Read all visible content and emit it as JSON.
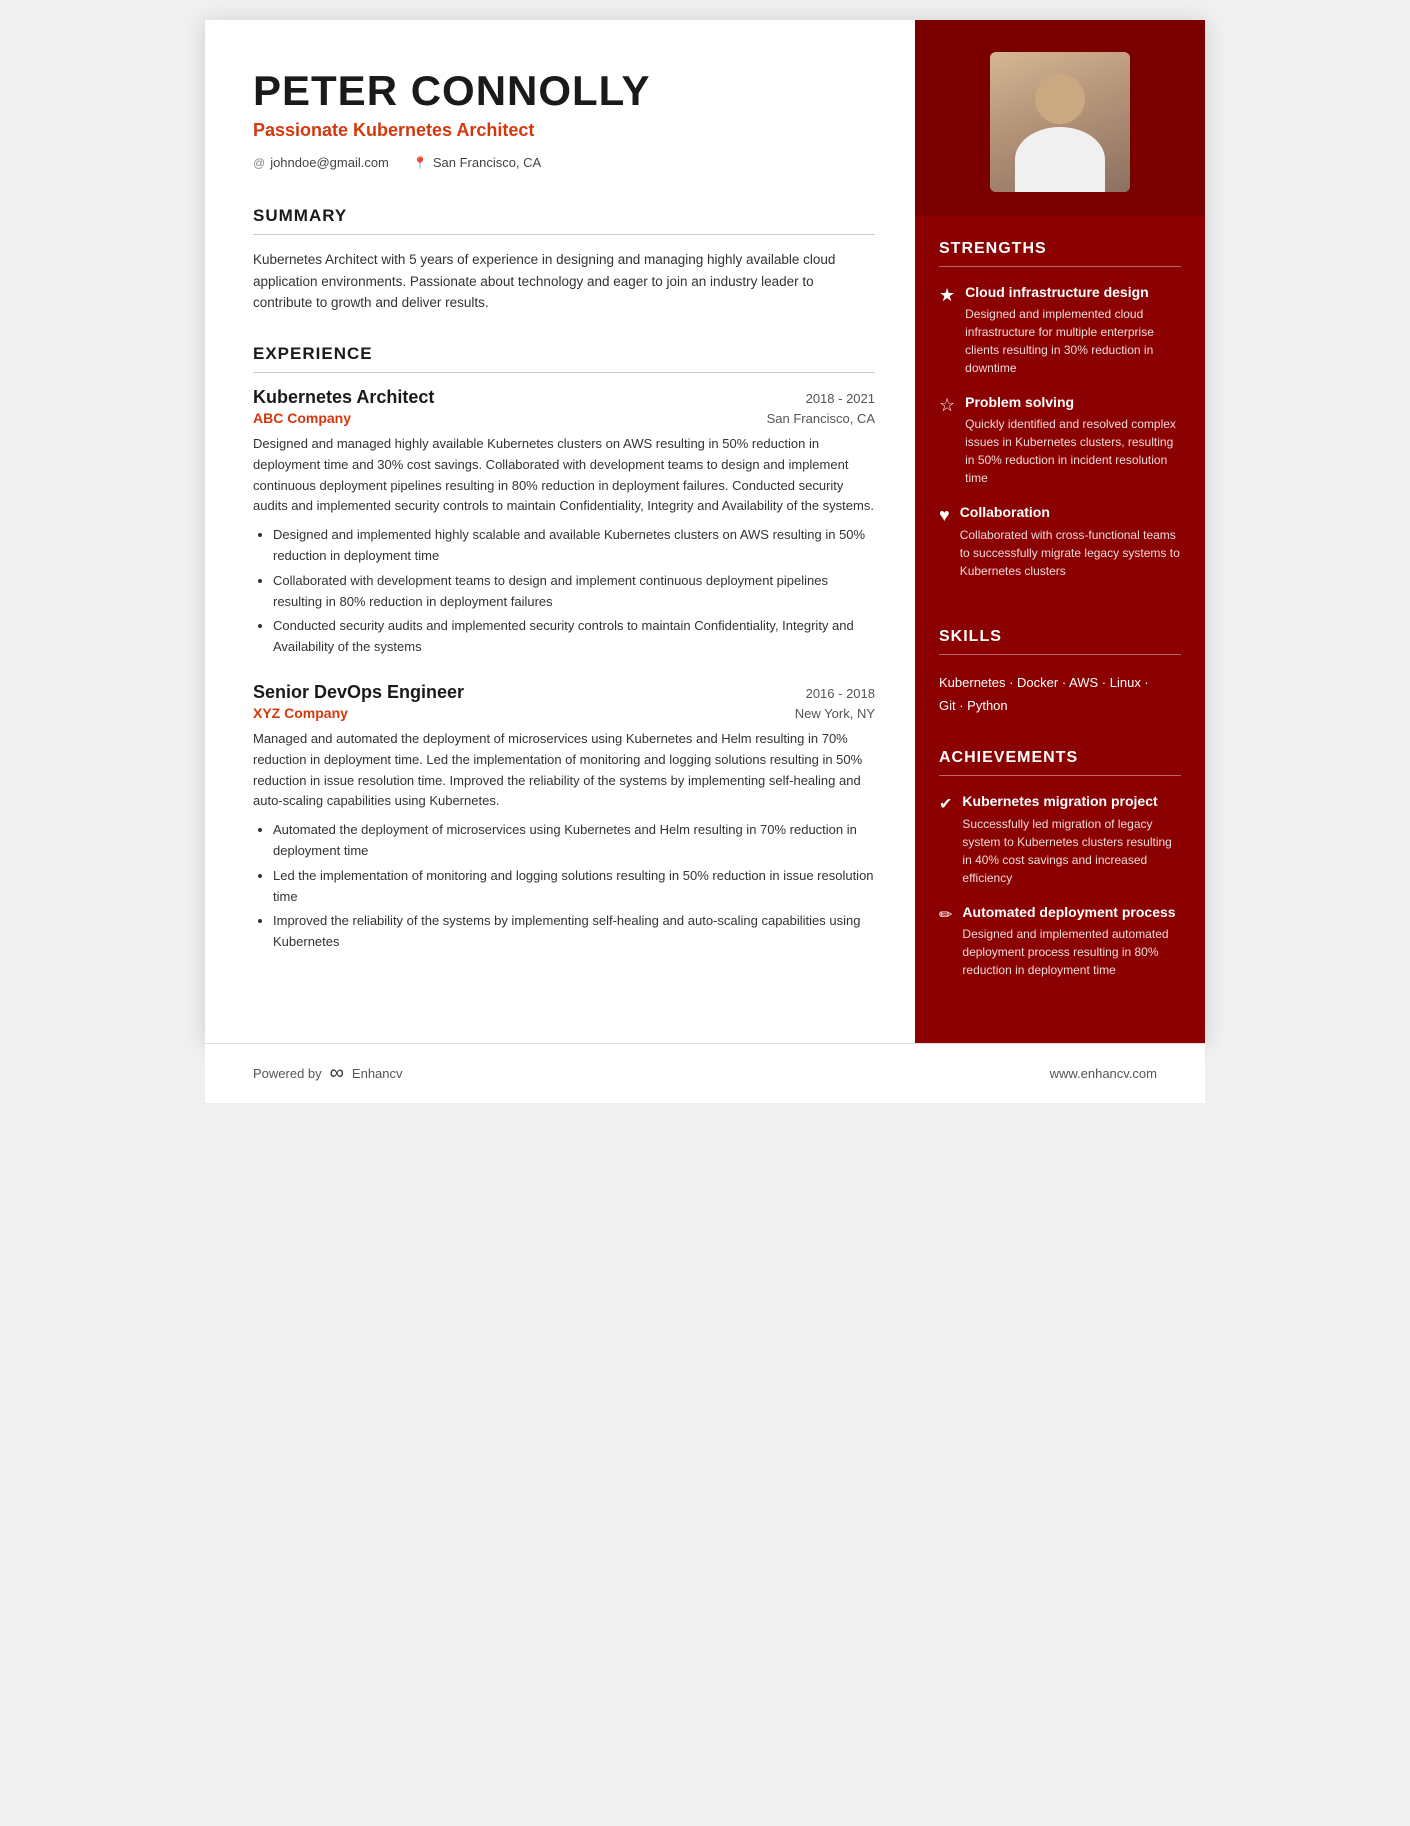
{
  "header": {
    "name": "PETER CONNOLLY",
    "title": "Passionate Kubernetes Architect",
    "email": "johndoe@gmail.com",
    "location": "San Francisco, CA"
  },
  "summary": {
    "section_title": "SUMMARY",
    "text": "Kubernetes Architect with 5 years of experience in designing and managing highly available cloud application environments. Passionate about technology and eager to join an industry leader to contribute to growth and deliver results."
  },
  "experience": {
    "section_title": "EXPERIENCE",
    "jobs": [
      {
        "title": "Kubernetes Architect",
        "company": "ABC Company",
        "dates": "2018 - 2021",
        "location": "San Francisco, CA",
        "description": "Designed and managed highly available Kubernetes clusters on AWS resulting in 50% reduction in deployment time and 30% cost savings. Collaborated with development teams to design and implement continuous deployment pipelines resulting in 80% reduction in deployment failures. Conducted security audits and implemented security controls to maintain Confidentiality, Integrity and Availability of the systems.",
        "bullets": [
          "Designed and implemented highly scalable and available Kubernetes clusters on AWS resulting in 50% reduction in deployment time",
          "Collaborated with development teams to design and implement continuous deployment pipelines resulting in 80% reduction in deployment failures",
          "Conducted security audits and implemented security controls to maintain Confidentiality, Integrity and Availability of the systems"
        ]
      },
      {
        "title": "Senior DevOps Engineer",
        "company": "XYZ Company",
        "dates": "2016 - 2018",
        "location": "New York, NY",
        "description": "Managed and automated the deployment of microservices using Kubernetes and Helm resulting in 70% reduction in deployment time. Led the implementation of monitoring and logging solutions resulting in 50% reduction in issue resolution time. Improved the reliability of the systems by implementing self-healing and auto-scaling capabilities using Kubernetes.",
        "bullets": [
          "Automated the deployment of microservices using Kubernetes and Helm resulting in 70% reduction in deployment time",
          "Led the implementation of monitoring and logging solutions resulting in 50% reduction in issue resolution time",
          "Improved the reliability of the systems by implementing self-healing and auto-scaling capabilities using Kubernetes"
        ]
      }
    ]
  },
  "strengths": {
    "section_title": "STRENGTHS",
    "items": [
      {
        "icon": "★",
        "title": "Cloud infrastructure design",
        "desc": "Designed and implemented cloud infrastructure for multiple enterprise clients resulting in 30% reduction in downtime"
      },
      {
        "icon": "☆",
        "title": "Problem solving",
        "desc": "Quickly identified and resolved complex issues in Kubernetes clusters, resulting in 50% reduction in incident resolution time"
      },
      {
        "icon": "♥",
        "title": "Collaboration",
        "desc": "Collaborated with cross-functional teams to successfully migrate legacy systems to Kubernetes clusters"
      }
    ]
  },
  "skills": {
    "section_title": "SKILLS",
    "line1": "Kubernetes · Docker · AWS · Linux ·",
    "line2": "Git · Python"
  },
  "achievements": {
    "section_title": "ACHIEVEMENTS",
    "items": [
      {
        "icon": "✔",
        "title": "Kubernetes migration project",
        "desc": "Successfully led migration of legacy system to Kubernetes clusters resulting in 40% cost savings and increased efficiency"
      },
      {
        "icon": "✏",
        "title": "Automated deployment process",
        "desc": "Designed and implemented automated deployment process resulting in 80% reduction in deployment time"
      }
    ]
  },
  "footer": {
    "powered_by": "Powered by",
    "brand": "Enhancv",
    "website": "www.enhancv.com"
  }
}
